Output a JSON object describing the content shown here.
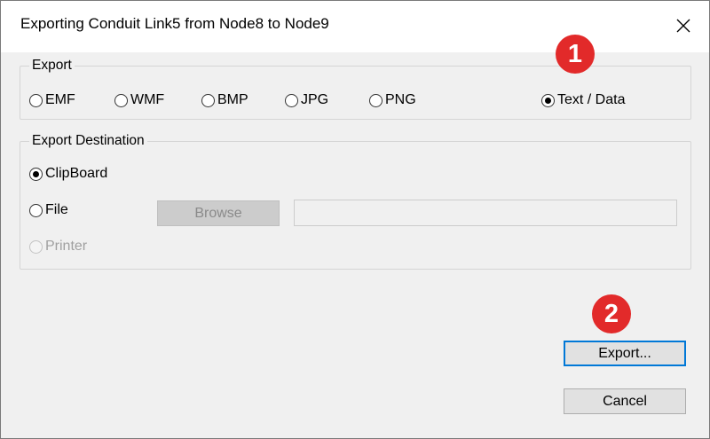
{
  "dialog": {
    "title": "Exporting Conduit Link5 from Node8 to Node9",
    "close_symbol": "✕"
  },
  "export_group": {
    "legend": "Export",
    "options": [
      "EMF",
      "WMF",
      "BMP",
      "JPG",
      "PNG",
      "Text / Data"
    ],
    "selected": "Text / Data"
  },
  "destination_group": {
    "legend": "Export Destination",
    "options": [
      "ClipBoard",
      "File",
      "Printer"
    ],
    "selected": "ClipBoard",
    "disabled": [
      "Printer"
    ],
    "browse_label": "Browse",
    "file_path": ""
  },
  "buttons": {
    "export_label": "Export...",
    "cancel_label": "Cancel"
  },
  "markers": [
    "1",
    "2"
  ],
  "colors": {
    "marker": "#e22a2a",
    "focus_border": "#0078d7"
  },
  "icons": {
    "close": "close-icon"
  }
}
